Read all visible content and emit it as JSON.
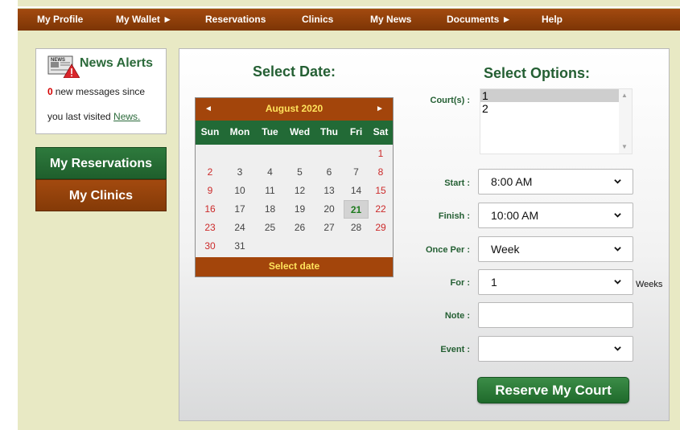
{
  "nav": {
    "items": [
      {
        "label": "My Profile"
      },
      {
        "label": "My Wallet ►"
      },
      {
        "label": "Reservations"
      },
      {
        "label": "Clinics"
      },
      {
        "label": "My News"
      },
      {
        "label": "Documents ►"
      },
      {
        "label": "Help"
      }
    ]
  },
  "news": {
    "icon_text": "NEWS",
    "title": "News Alerts",
    "count": "0",
    "line1": "new messages since",
    "line2_prefix": "you last visited",
    "link": "News."
  },
  "sidebar": {
    "reservations_label": "My Reservations",
    "clinics_label": "My Clinics"
  },
  "main": {
    "select_date_title": "Select Date:",
    "select_options_title": "Select Options:"
  },
  "calendar": {
    "prev_symbol": "◄",
    "next_symbol": "►",
    "month_label": "August 2020",
    "days_of_week": [
      "Sun",
      "Mon",
      "Tue",
      "Wed",
      "Thu",
      "Fri",
      "Sat"
    ],
    "weeks": [
      [
        "",
        "",
        "",
        "",
        "",
        "",
        "1"
      ],
      [
        "2",
        "3",
        "4",
        "5",
        "6",
        "7",
        "8"
      ],
      [
        "9",
        "10",
        "11",
        "12",
        "13",
        "14",
        "15"
      ],
      [
        "16",
        "17",
        "18",
        "19",
        "20",
        "21",
        "22"
      ],
      [
        "23",
        "24",
        "25",
        "26",
        "27",
        "28",
        "29"
      ],
      [
        "30",
        "31",
        "",
        "",
        "",
        "",
        ""
      ]
    ],
    "selected_day": "21",
    "footer_label": "Select date"
  },
  "options": {
    "courts_label": "Court(s) :",
    "courts": [
      "1",
      "2"
    ],
    "courts_selected": "1",
    "start_label": "Start :",
    "start_value": "8:00 AM",
    "finish_label": "Finish :",
    "finish_value": "10:00 AM",
    "once_per_label": "Once Per :",
    "once_per_value": "Week",
    "for_label": "For :",
    "for_value": "1",
    "for_unit": "Weeks",
    "note_label": "Note :",
    "note_value": "",
    "event_label": "Event :",
    "event_value": "",
    "reserve_label": "Reserve My Court"
  },
  "colors": {
    "nav_brown": "#a34a0f",
    "green": "#245f33",
    "weekend_red": "#cc2a2a",
    "calendar_gold": "#ffe35c"
  }
}
